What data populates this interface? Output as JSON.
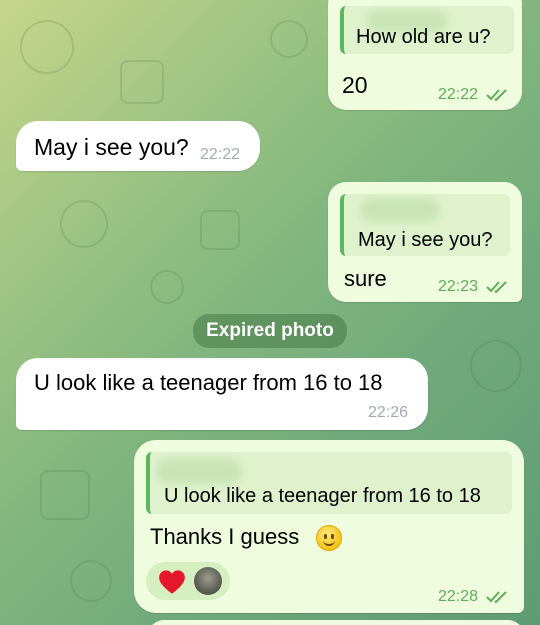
{
  "messages": {
    "m1": {
      "quote_text": "How old are u?",
      "text": "20",
      "time": "22:22"
    },
    "m2": {
      "text": "May i see you?",
      "time": "22:22"
    },
    "m3": {
      "quote_text": "May i see you?",
      "text": "sure",
      "time": "22:23"
    },
    "service": {
      "text": "Expired photo"
    },
    "m4": {
      "text": "U look like a teenager from 16 to 18",
      "time": "22:26"
    },
    "m5": {
      "quote_text": "U look like a teenager from 16 to 18",
      "text": "Thanks I guess",
      "time": "22:28"
    }
  },
  "icons": {
    "read_receipt": "double-check-icon",
    "smile_emoji": "slightly-smiling-face-icon",
    "heart_reaction": "red-heart-icon",
    "reactor_avatar": "avatar"
  },
  "colors": {
    "outgoing_bubble": "#effdde",
    "incoming_bubble": "#ffffff",
    "accent_green": "#5fae5b",
    "quote_bar": "#5cb85c"
  }
}
